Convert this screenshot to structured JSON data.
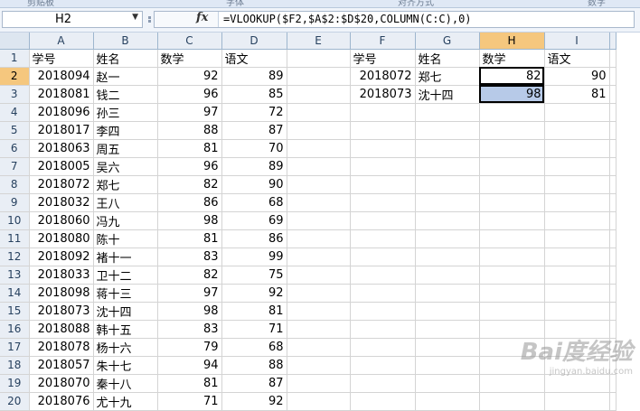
{
  "ribbon": [
    "剪贴板",
    "字体",
    "对齐方式",
    "数字"
  ],
  "name_box": "H2",
  "fx_symbol": "fx",
  "formula": "=VLOOKUP($F2,$A$2:$D$20,COLUMN(C:C),0)",
  "columns": [
    "A",
    "B",
    "C",
    "D",
    "E",
    "F",
    "G",
    "H",
    "I"
  ],
  "active_cell": "H2",
  "rows": [
    [
      "学号",
      "姓名",
      "数学",
      "语文",
      "",
      "学号",
      "姓名",
      "数学",
      "语文"
    ],
    [
      "2018094",
      "赵一",
      "92",
      "89",
      "",
      "2018072",
      "郑七",
      "82",
      "90"
    ],
    [
      "2018081",
      "钱二",
      "96",
      "85",
      "",
      "2018073",
      "沈十四",
      "98",
      "81"
    ],
    [
      "2018096",
      "孙三",
      "97",
      "72",
      "",
      "",
      "",
      "",
      ""
    ],
    [
      "2018017",
      "李四",
      "88",
      "87",
      "",
      "",
      "",
      "",
      ""
    ],
    [
      "2018063",
      "周五",
      "81",
      "70",
      "",
      "",
      "",
      "",
      ""
    ],
    [
      "2018005",
      "吴六",
      "96",
      "89",
      "",
      "",
      "",
      "",
      ""
    ],
    [
      "2018072",
      "郑七",
      "82",
      "90",
      "",
      "",
      "",
      "",
      ""
    ],
    [
      "2018032",
      "王八",
      "86",
      "68",
      "",
      "",
      "",
      "",
      ""
    ],
    [
      "2018060",
      "冯九",
      "98",
      "69",
      "",
      "",
      "",
      "",
      ""
    ],
    [
      "2018080",
      "陈十",
      "81",
      "86",
      "",
      "",
      "",
      "",
      ""
    ],
    [
      "2018092",
      "褚十一",
      "83",
      "99",
      "",
      "",
      "",
      "",
      ""
    ],
    [
      "2018033",
      "卫十二",
      "82",
      "75",
      "",
      "",
      "",
      "",
      ""
    ],
    [
      "2018098",
      "蒋十三",
      "97",
      "92",
      "",
      "",
      "",
      "",
      ""
    ],
    [
      "2018073",
      "沈十四",
      "98",
      "81",
      "",
      "",
      "",
      "",
      ""
    ],
    [
      "2018088",
      "韩十五",
      "83",
      "71",
      "",
      "",
      "",
      "",
      ""
    ],
    [
      "2018078",
      "杨十六",
      "79",
      "68",
      "",
      "",
      "",
      "",
      ""
    ],
    [
      "2018057",
      "朱十七",
      "94",
      "88",
      "",
      "",
      "",
      "",
      ""
    ],
    [
      "2018070",
      "秦十八",
      "81",
      "87",
      "",
      "",
      "",
      "",
      ""
    ],
    [
      "2018076",
      "尤十九",
      "71",
      "92",
      "",
      "",
      "",
      "",
      ""
    ]
  ],
  "watermark": {
    "brand": "Bai度经验",
    "url": "jingyan.baidu.com"
  }
}
